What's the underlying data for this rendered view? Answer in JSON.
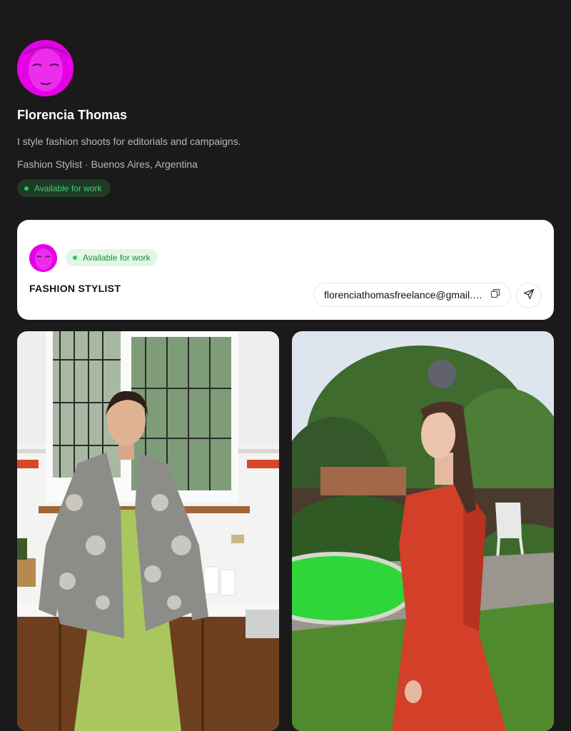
{
  "profile": {
    "name": "Florencia Thomas",
    "bio": "I style fashion shoots for editorials and campaigns.",
    "meta": "Fashion Stylist · Buenos Aires, Argentina",
    "status": "Available for work"
  },
  "card": {
    "status": "Available for work",
    "role": "FASHION STYLIST",
    "email": "florenciathomasfreelance@gmail.com",
    "copy_icon": "copy-icon",
    "send_icon": "send-icon"
  },
  "colors": {
    "background": "#1a1a1a",
    "avatar": "#e600e6",
    "status_green": "#2ecc5b"
  }
}
